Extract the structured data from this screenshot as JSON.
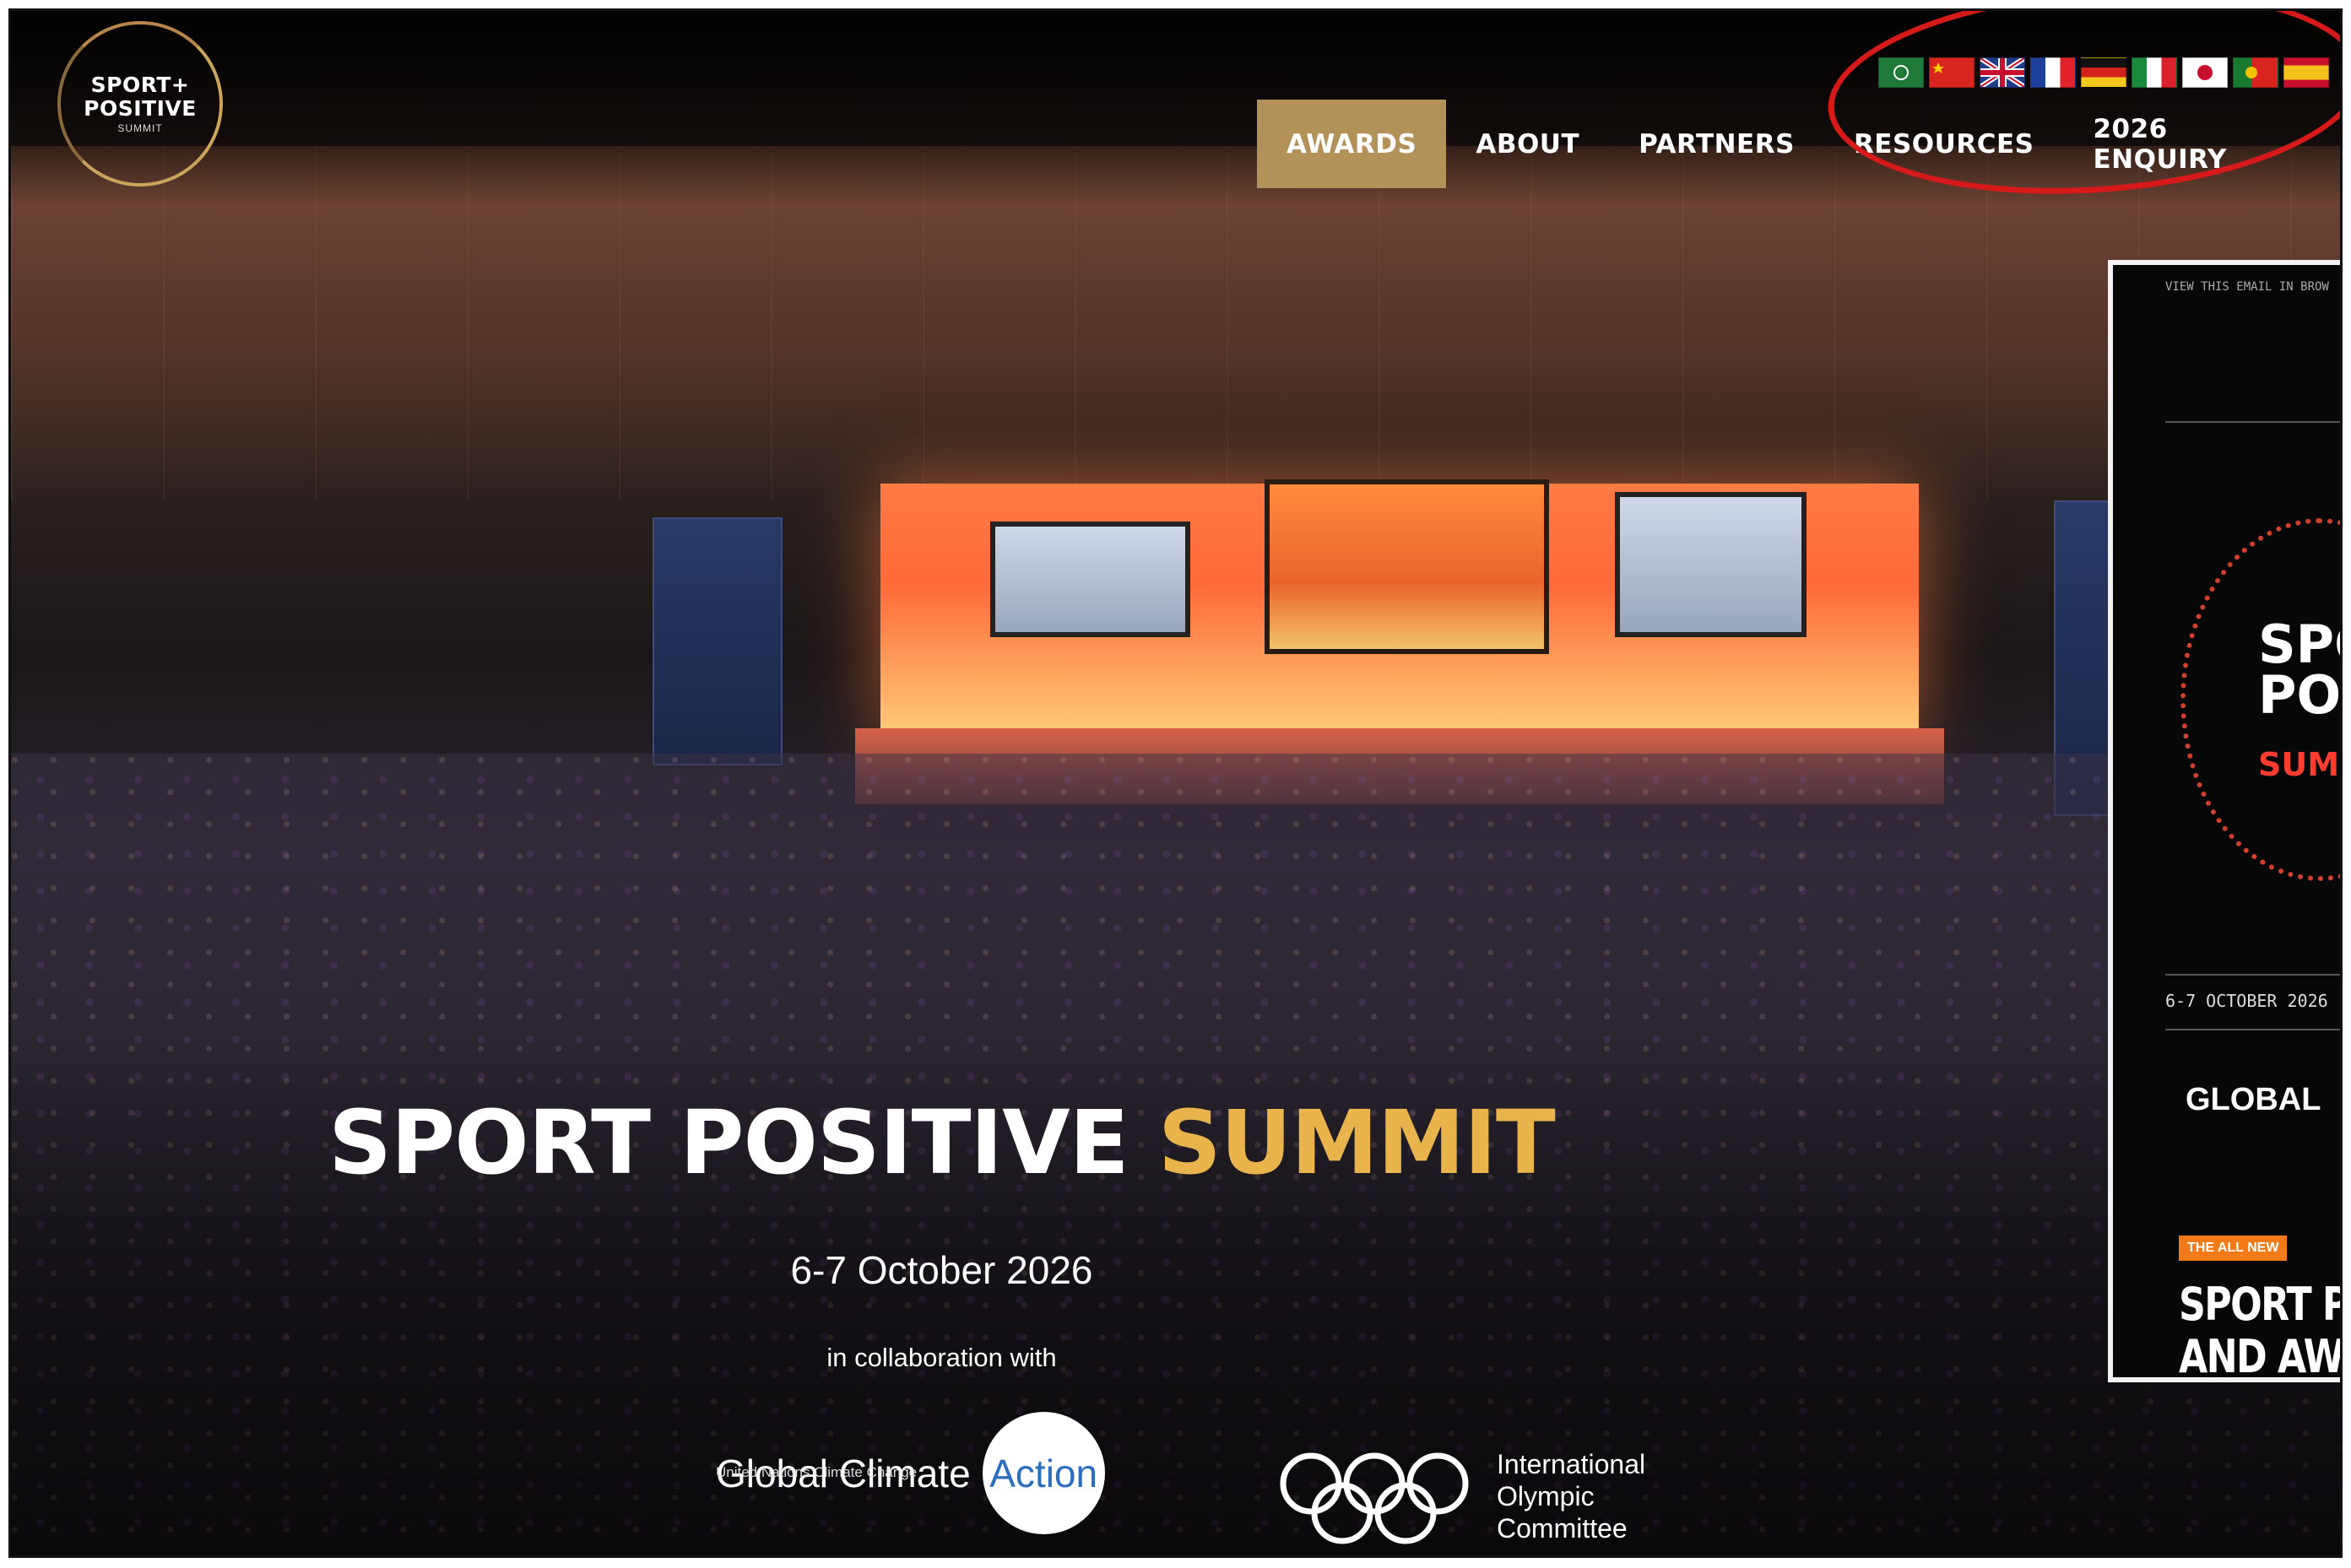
{
  "logo": {
    "line1": "SPORT+",
    "line2": "POSITIVE",
    "line3": "SUMMIT"
  },
  "nav": {
    "items": [
      {
        "label": "AWARDS",
        "active": true
      },
      {
        "label": "ABOUT",
        "active": false
      },
      {
        "label": "PARTNERS",
        "active": false
      },
      {
        "label": "RESOURCES",
        "active": false
      },
      {
        "label": "2026 ENQUIRY",
        "active": false
      }
    ]
  },
  "languages": [
    "arabic-flag-icon",
    "china-flag-icon",
    "uk-flag-icon",
    "france-flag-icon",
    "germany-flag-icon",
    "italy-flag-icon",
    "japan-flag-icon",
    "portugal-flag-icon",
    "spain-flag-icon"
  ],
  "hero": {
    "title_main": "SPORT POSITIVE",
    "title_accent": "SUMMIT",
    "date": "6-7 October 2026",
    "collab_text": "in collaboration with"
  },
  "partners": {
    "gca_name": "Global Climate",
    "gca_action": "Action",
    "gca_sub": "United Nations Climate Change",
    "ioc_line1": "International",
    "ioc_line2": "Olympic",
    "ioc_line3": "Committee"
  },
  "email": {
    "view_link": "VIEW THIS EMAIL IN BROW",
    "logo_l1": "SPO",
    "logo_l2": "POS",
    "logo_l3": "SUMM",
    "date": "6-7 OCTOBER 2026",
    "global": "GLOBAL",
    "badge": "THE ALL NEW",
    "headline_l1": "SPORT PO",
    "headline_l2": "AND AWA"
  },
  "colors": {
    "accent_gold": "#e9b44c",
    "nav_active_bg": "#b3925a",
    "annotation_red": "#d61a1a",
    "email_red": "#ff3d2e"
  }
}
